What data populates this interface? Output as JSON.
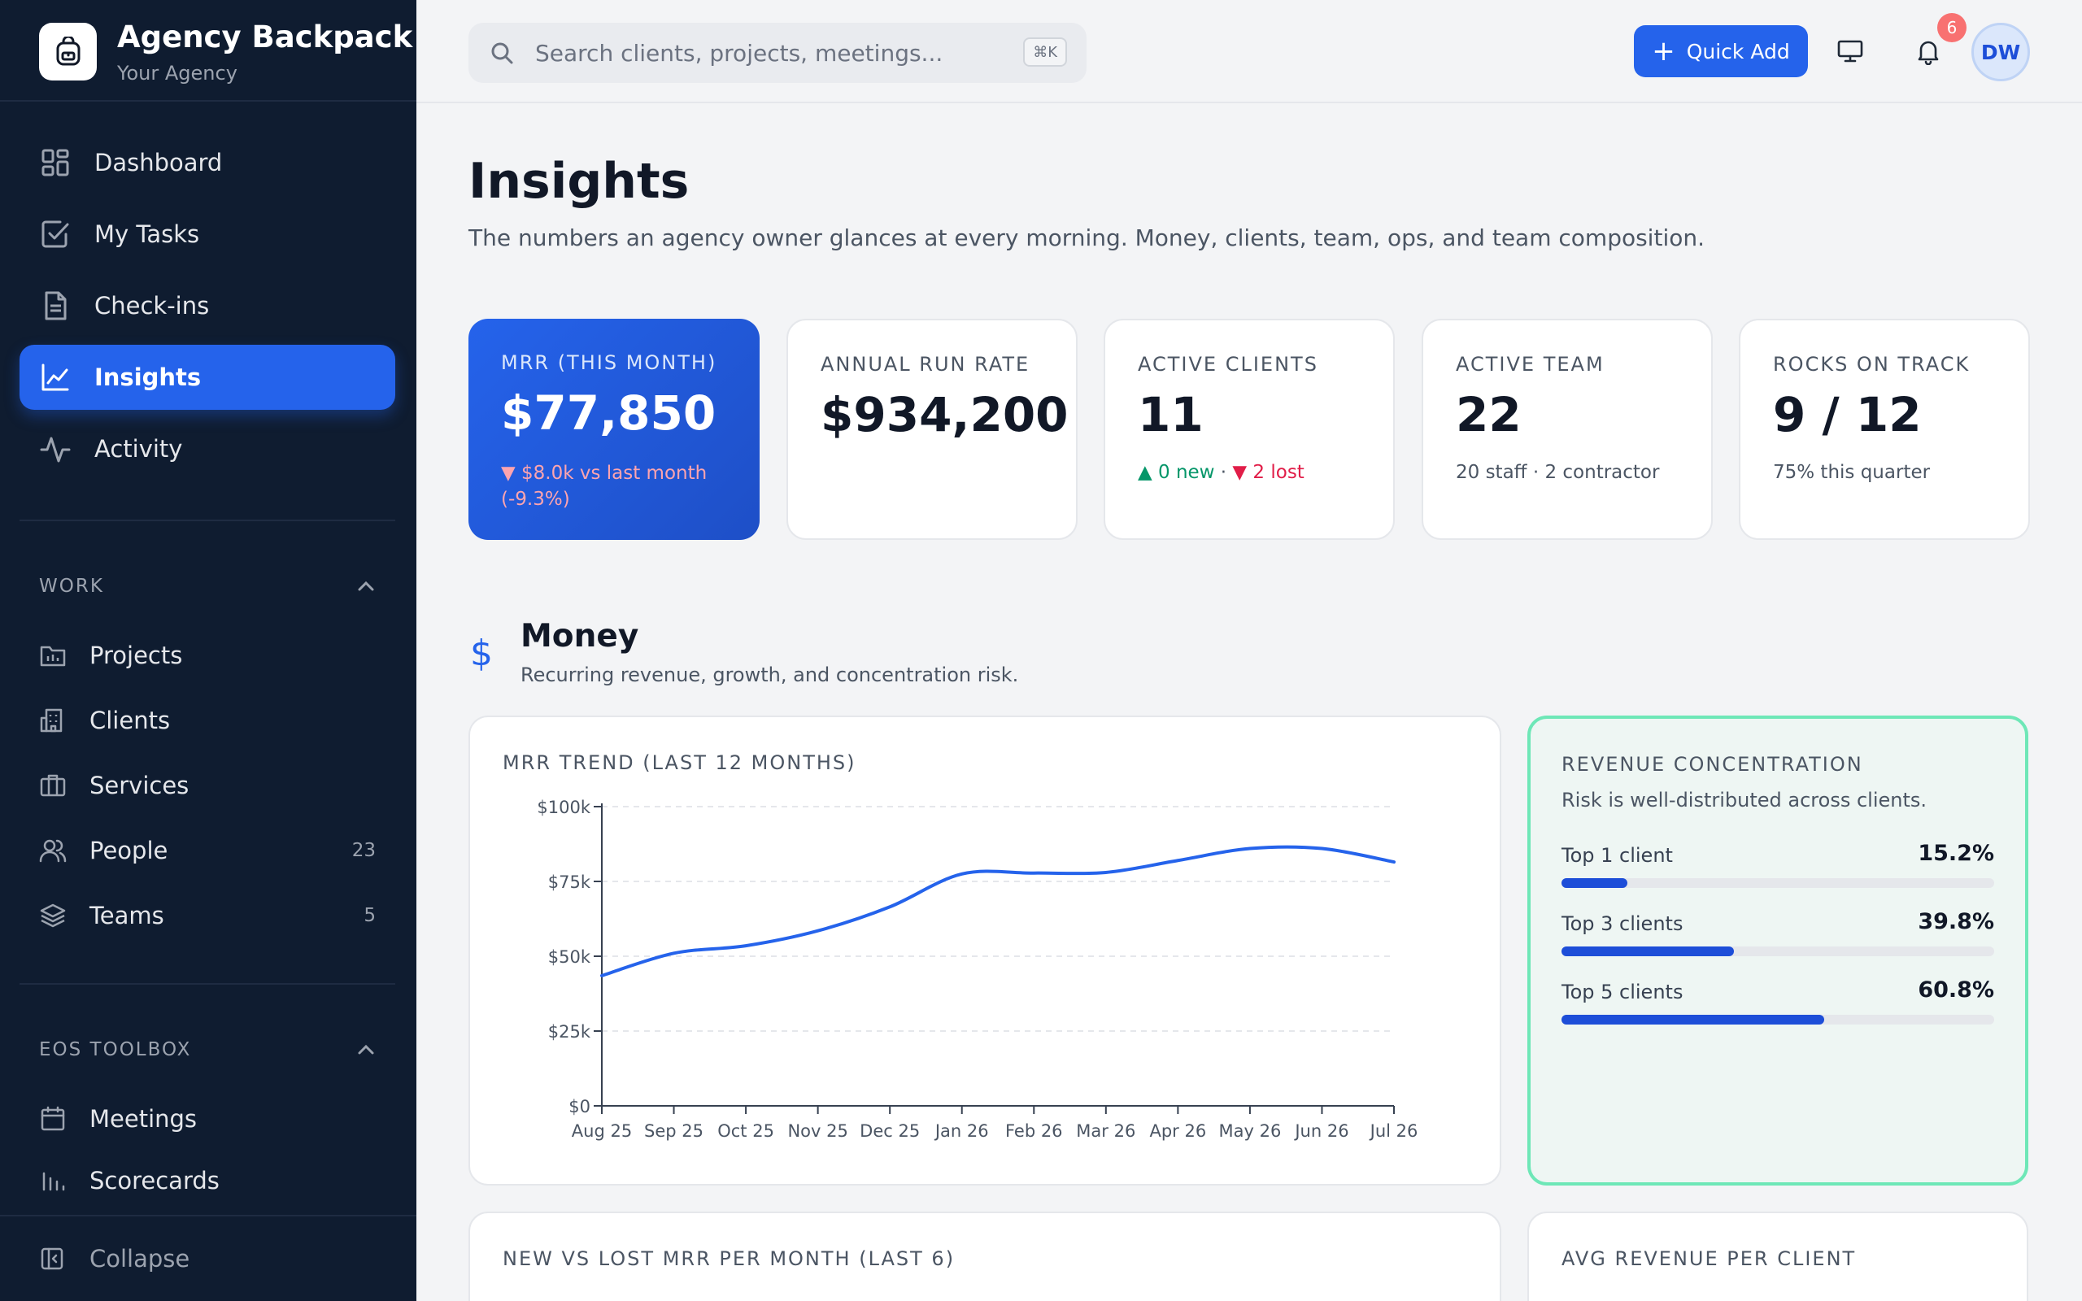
{
  "brand": {
    "name": "Agency Backpack",
    "subtitle": "Your Agency",
    "icon": "backpack-icon"
  },
  "nav": {
    "items": [
      {
        "label": "Dashboard",
        "icon": "grid-icon"
      },
      {
        "label": "My Tasks",
        "icon": "checkbox-icon"
      },
      {
        "label": "Check-ins",
        "icon": "document-icon"
      },
      {
        "label": "Insights",
        "icon": "line-chart-icon",
        "active": true
      },
      {
        "label": "Activity",
        "icon": "pulse-icon"
      }
    ],
    "work": {
      "title": "WORK",
      "items": [
        {
          "label": "Projects",
          "icon": "folder-icon"
        },
        {
          "label": "Clients",
          "icon": "building-icon"
        },
        {
          "label": "Services",
          "icon": "briefcase-icon"
        },
        {
          "label": "People",
          "icon": "people-icon",
          "count": "23"
        },
        {
          "label": "Teams",
          "icon": "layers-icon",
          "count": "5"
        }
      ]
    },
    "eos": {
      "title": "EOS TOOLBOX",
      "items": [
        {
          "label": "Meetings",
          "icon": "calendar-icon"
        },
        {
          "label": "Scorecards",
          "icon": "bar-chart-icon"
        }
      ]
    },
    "collapse_label": "Collapse"
  },
  "topbar": {
    "search_placeholder": "Search clients, projects, meetings...",
    "search_shortcut": "⌘K",
    "quick_add_label": "Quick Add",
    "notification_count": "6",
    "avatar_initials": "DW"
  },
  "page": {
    "title": "Insights",
    "subtitle": "The numbers an agency owner glances at every morning. Money, clients, team, ops, and team composition."
  },
  "kpis": {
    "mrr": {
      "label": "MRR (THIS MONTH)",
      "value": "$77,850",
      "note": "▼ $8.0k vs last month (-9.3%)"
    },
    "arr": {
      "label": "ANNUAL RUN RATE",
      "value": "$934,200"
    },
    "clients": {
      "label": "ACTIVE CLIENTS",
      "value": "11",
      "new_note": "▲ 0 new",
      "separator": " · ",
      "lost_note": "▼ 2 lost"
    },
    "team": {
      "label": "ACTIVE TEAM",
      "value": "22",
      "note": "20 staff · 2 contractor"
    },
    "rocks": {
      "label": "ROCKS ON TRACK",
      "value": "9 / 12",
      "note": "75% this quarter"
    }
  },
  "money": {
    "icon": "dollar-icon",
    "title": "Money",
    "subtitle": "Recurring revenue, growth, and concentration risk.",
    "concentration": {
      "title": "REVENUE CONCENTRATION",
      "subtitle": "Risk is well-distributed across clients.",
      "rows": [
        {
          "label": "Top 1 client",
          "value": "15.2%",
          "fraction": 0.152
        },
        {
          "label": "Top 3 clients",
          "value": "39.8%",
          "fraction": 0.398
        },
        {
          "label": "Top 5 clients",
          "value": "60.8%",
          "fraction": 0.608
        }
      ]
    },
    "new_vs_lost_title": "NEW VS LOST MRR PER MONTH (LAST 6)",
    "avg_revenue_title": "AVG REVENUE PER CLIENT"
  },
  "chart_data": {
    "type": "line",
    "title": "MRR TREND (LAST 12 MONTHS)",
    "x": [
      "Aug 25",
      "Sep 25",
      "Oct 25",
      "Nov 25",
      "Dec 25",
      "Jan 26",
      "Feb 26",
      "Mar 26",
      "Apr 26",
      "May 26",
      "Jun 26",
      "Jul 26"
    ],
    "series": [
      {
        "values": [
          43500,
          51000,
          53500,
          58500,
          66500,
          77500,
          77800,
          78000,
          82000,
          86000,
          86000,
          81500
        ]
      }
    ],
    "ylim": [
      0,
      100000
    ],
    "yticks": [
      "$0",
      "$25k",
      "$50k",
      "$75k",
      "$100k"
    ],
    "ytick_values": [
      0,
      25000,
      50000,
      75000,
      100000
    ],
    "grid": true,
    "color": "#2563eb"
  }
}
